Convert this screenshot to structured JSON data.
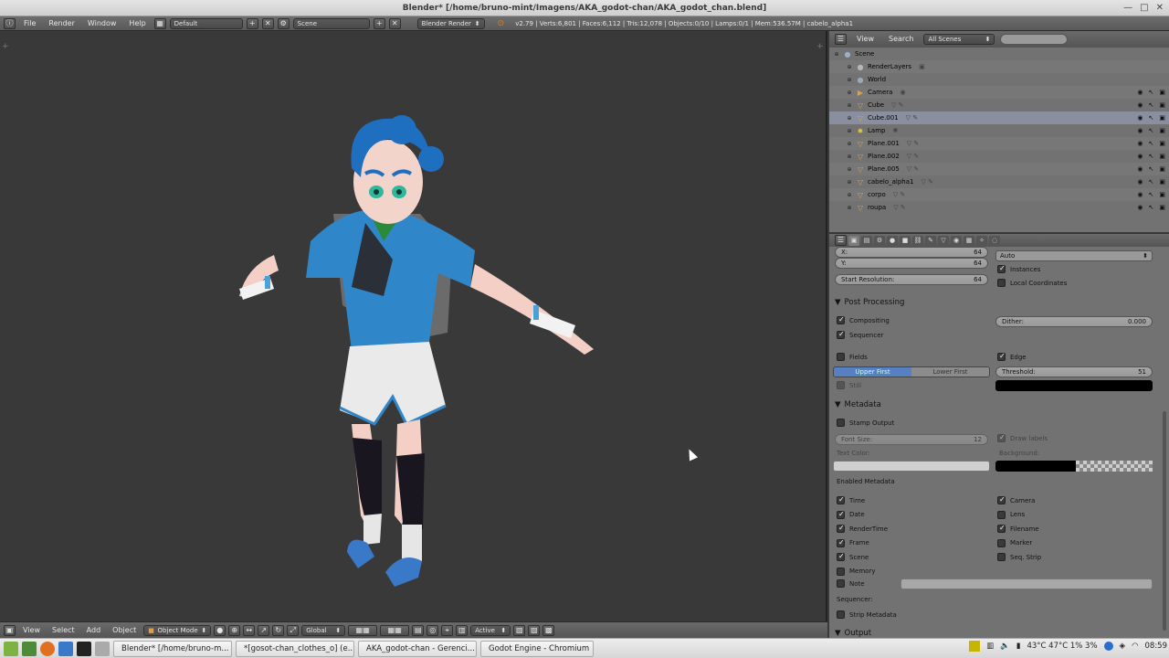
{
  "window": {
    "title": "Blender* [/home/bruno-mint/Imagens/AKA_godot-chan/AKA_godot_chan.blend]",
    "minimize": "—",
    "maximize": "□",
    "close": "✕"
  },
  "infobar": {
    "menus": [
      "File",
      "Render",
      "Window",
      "Help"
    ],
    "screen_layout": "Default",
    "scene": "Scene",
    "engine": "Blender Render",
    "stats": "v2.79 | Verts:6,801 | Faces:6,112 | Tris:12,078 | Objects:0/10 | Lamps:0/1 | Mem:536.57M | cabelo_alpha1"
  },
  "viewport": {
    "corner_plus": "+"
  },
  "view3d_header": {
    "menus": [
      "View",
      "Select",
      "Add",
      "Object"
    ],
    "mode": "Object Mode",
    "orientation": "Global",
    "pivot": "Active"
  },
  "outliner": {
    "header_menus": [
      "View",
      "Search"
    ],
    "display_mode": "All Scenes",
    "rows": [
      {
        "name": "Scene",
        "icon": "scene-icon",
        "color": "#9db0c8",
        "indent": 0,
        "tools": false,
        "sub": ""
      },
      {
        "name": "RenderLayers",
        "icon": "renderlayers-icon",
        "color": "#b8b8b8",
        "indent": 1,
        "tools": false,
        "sub": "▣"
      },
      {
        "name": "World",
        "icon": "world-icon",
        "color": "#9ab",
        "indent": 1,
        "tools": false,
        "sub": ""
      },
      {
        "name": "Camera",
        "icon": "camera-icon",
        "color": "#e0a040",
        "indent": 1,
        "tools": true,
        "sub": "◉"
      },
      {
        "name": "Cube",
        "icon": "mesh-icon",
        "color": "#e0a040",
        "indent": 1,
        "tools": true,
        "sub": "▽ ✎"
      },
      {
        "name": "Cube.001",
        "icon": "mesh-icon",
        "color": "#e0a040",
        "indent": 1,
        "tools": true,
        "sub": "▽ ✎"
      },
      {
        "name": "Lamp",
        "icon": "lamp-icon",
        "color": "#e0c040",
        "indent": 1,
        "tools": true,
        "sub": "✺"
      },
      {
        "name": "Plane.001",
        "icon": "mesh-icon",
        "color": "#e0a040",
        "indent": 1,
        "tools": true,
        "sub": "▽ ✎"
      },
      {
        "name": "Plane.002",
        "icon": "mesh-icon",
        "color": "#e0a040",
        "indent": 1,
        "tools": true,
        "sub": "▽ ✎"
      },
      {
        "name": "Plane.005",
        "icon": "mesh-icon",
        "color": "#e0a040",
        "indent": 1,
        "tools": true,
        "sub": "▽ ✎"
      },
      {
        "name": "cabelo_alpha1",
        "icon": "mesh-icon",
        "color": "#e0a040",
        "indent": 1,
        "tools": true,
        "sub": "▽ ✎"
      },
      {
        "name": "corpo",
        "icon": "mesh-icon",
        "color": "#e0a040",
        "indent": 1,
        "tools": true,
        "sub": "▽ ✎"
      },
      {
        "name": "roupa",
        "icon": "mesh-icon",
        "color": "#e0a040",
        "indent": 1,
        "tools": true,
        "sub": "▽ ✎"
      }
    ]
  },
  "properties": {
    "x_label": "X:",
    "x_value": "64",
    "y_label": "Y:",
    "y_value": "64",
    "start_res_label": "Start Resolution:",
    "start_res_value": "64",
    "auto_option": "Auto",
    "instances": "Instances",
    "local_coords": "Local Coordinates",
    "post_processing": "Post Processing",
    "compositing": "Compositing",
    "sequencer": "Sequencer",
    "dither_label": "Dither:",
    "dither_value": "0.000",
    "fields": "Fields",
    "edge": "Edge",
    "upper_first": "Upper First",
    "lower_first": "Lower First",
    "threshold_label": "Threshold:",
    "threshold_value": "51",
    "still": "Still",
    "metadata": "Metadata",
    "stamp_output": "Stamp Output",
    "font_size_label": "Font Size:",
    "font_size_value": "12",
    "draw_labels": "Draw labels",
    "text_color": "Text Color:",
    "background": "Background:",
    "enabled_metadata": "Enabled Metadata",
    "meta_left": [
      {
        "label": "Time",
        "checked": true
      },
      {
        "label": "Date",
        "checked": true
      },
      {
        "label": "RenderTime",
        "checked": true
      },
      {
        "label": "Frame",
        "checked": true
      },
      {
        "label": "Scene",
        "checked": true
      },
      {
        "label": "Memory",
        "checked": false
      }
    ],
    "meta_right": [
      {
        "label": "Camera",
        "checked": true
      },
      {
        "label": "Lens",
        "checked": false
      },
      {
        "label": "Filename",
        "checked": true
      },
      {
        "label": "Marker",
        "checked": false
      },
      {
        "label": "Seq. Strip",
        "checked": false
      }
    ],
    "note": "Note",
    "sequencer_label": "Sequencer:",
    "strip_metadata": "Strip Metadata",
    "output": "Output"
  },
  "taskbar": {
    "tasks": [
      {
        "label": "Blender* [/home/bruno-m...",
        "color": "#e08020"
      },
      {
        "label": "*[gosot-chan_clothes_o] (e...",
        "color": "#666"
      },
      {
        "label": "AKA_godot-chan - Gerenci...",
        "color": "#8aa040"
      },
      {
        "label": "Godot Engine - Chromium",
        "color": "#3a78c8"
      }
    ],
    "sensors": "43°C 47°C 1% 3%",
    "clock": "08:59"
  }
}
